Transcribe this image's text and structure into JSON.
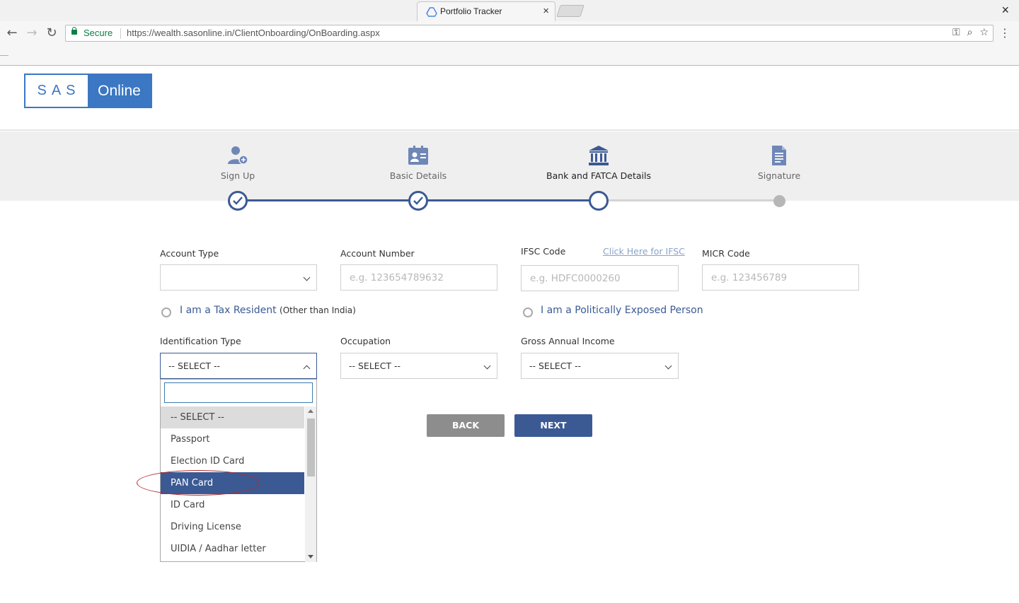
{
  "browser": {
    "tab_title": "Portfolio Tracker",
    "tab_close": "×",
    "window_close": "×",
    "secure_label": "Secure",
    "url": "https://wealth.sasonline.in/ClientOnboarding/OnBoarding.aspx"
  },
  "logo": {
    "left": "SAS",
    "right": "Online"
  },
  "steps": [
    {
      "label": "Sign Up",
      "state": "done"
    },
    {
      "label": "Basic Details",
      "state": "done"
    },
    {
      "label": "Bank and FATCA Details",
      "state": "current"
    },
    {
      "label": "Signature",
      "state": "pending"
    }
  ],
  "form": {
    "account_type_label": "Account Type",
    "account_type_value": "",
    "account_number_label": "Account Number",
    "account_number_placeholder": "e.g. 123654789632",
    "ifsc_label": "IFSC Code",
    "ifsc_link": "Click Here for IFSC",
    "ifsc_placeholder": "e.g. HDFC0000260",
    "micr_label": "MICR Code",
    "micr_placeholder": "e.g. 123456789",
    "tax_resident_label": "I am a Tax Resident",
    "tax_resident_note": "(Other than India)",
    "pep_label": "I am a Politically Exposed Person",
    "identification_label": "Identification Type",
    "identification_value": "-- SELECT --",
    "occupation_label": "Occupation",
    "occupation_value": "-- SELECT --",
    "income_label": "Gross Annual Income",
    "income_value": "-- SELECT --"
  },
  "dropdown": {
    "search_value": "",
    "options": [
      "-- SELECT --",
      "Passport",
      "Election ID Card",
      "PAN Card",
      "ID Card",
      "Driving License",
      "UIDIA / Aadhar letter"
    ],
    "current_index": 0,
    "highlighted_index": 3
  },
  "buttons": {
    "back": "BACK",
    "next": "NEXT"
  },
  "colors": {
    "primary": "#3b5a94",
    "logo_blue": "#3b77c3",
    "secure_green": "#0b8043",
    "annotation_red": "#b52a2a"
  }
}
